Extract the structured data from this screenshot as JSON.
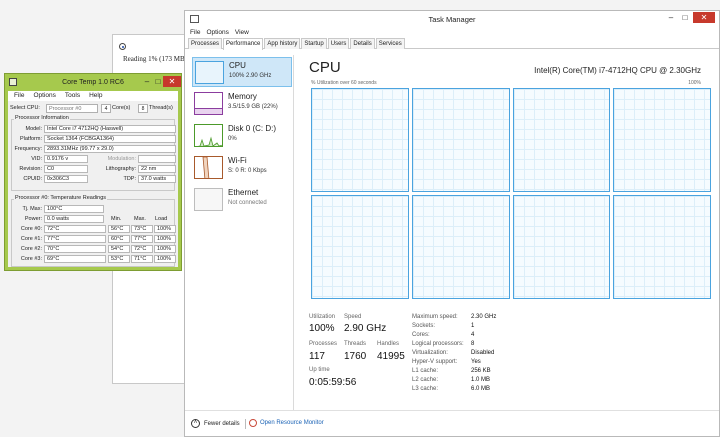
{
  "background_window": {
    "text": "Reading 1% (173 MB)"
  },
  "coretemp": {
    "title": "Core Temp 1.0 RC6",
    "menu": [
      "File",
      "Options",
      "Tools",
      "Help"
    ],
    "select_cpu_label": "Select CPU:",
    "select_cpu_value": "Processor #0",
    "cores_value": "4",
    "cores_label": "Core(s)",
    "threads_value": "8",
    "threads_label": "Thread(s)",
    "proc_info_title": "Processor Information",
    "model_label": "Model:",
    "model_value": "Intel Core i7 4712HQ (Haswell)",
    "platform_label": "Platform:",
    "platform_value": "Socket 1364 (FCBGA1364)",
    "frequency_label": "Frequency:",
    "frequency_value": "2893.31MHz (99.77 x 29.0)",
    "vid_label": "VID:",
    "vid_value": "0.9176 v",
    "modulation_label": "Modulation:",
    "modulation_value": "",
    "revision_label": "Revision:",
    "revision_value": "C0",
    "lithography_label": "Lithography:",
    "lithography_value": "22 nm",
    "cpuid_label": "CPUID:",
    "cpuid_value": "0x306C3",
    "tdp_label": "TDP:",
    "tdp_value": "37.0 watts",
    "temp_title": "Processor #0: Temperature Readings",
    "tjmax_label": "Tj. Max:",
    "tjmax_value": "100°C",
    "power_label": "Power:",
    "power_value": "0.0 watts",
    "col_min": "Min.",
    "col_max": "Max.",
    "col_load": "Load",
    "cores": [
      {
        "label": "Core #0:",
        "temp": "72°C",
        "min": "56°C",
        "max": "73°C",
        "load": "100%"
      },
      {
        "label": "Core #1:",
        "temp": "77°C",
        "min": "60°C",
        "max": "77°C",
        "load": "100%"
      },
      {
        "label": "Core #2:",
        "temp": "70°C",
        "min": "54°C",
        "max": "72°C",
        "load": "100%"
      },
      {
        "label": "Core #3:",
        "temp": "69°C",
        "min": "53°C",
        "max": "71°C",
        "load": "100%"
      }
    ]
  },
  "taskmanager": {
    "title": "Task Manager",
    "menu": [
      "File",
      "Options",
      "View"
    ],
    "tabs": [
      "Processes",
      "Performance",
      "App history",
      "Startup",
      "Users",
      "Details",
      "Services"
    ],
    "active_tab": 1,
    "sidebar": [
      {
        "name": "CPU",
        "sub": "100% 2.90 GHz",
        "color": "#4aa3df"
      },
      {
        "name": "Memory",
        "sub": "3.5/15.9 GB (22%)",
        "color": "#8b3d9e"
      },
      {
        "name": "Disk 0 (C: D:)",
        "sub": "0%",
        "color": "#4c9a2a"
      },
      {
        "name": "Wi-Fi",
        "sub": "S: 0 R: 0 Kbps",
        "color": "#a85a2c"
      },
      {
        "name": "Ethernet",
        "sub": "Not connected",
        "color": "#999999"
      }
    ],
    "cpu_title": "CPU",
    "cpu_name": "Intel(R) Core(TM) i7-4712HQ CPU @ 2.30GHz",
    "util_label": "% Utilization over 60 seconds",
    "util_max": "100%",
    "stats": {
      "utilization_label": "Utilization",
      "utilization_value": "100%",
      "speed_label": "Speed",
      "speed_value": "2.90 GHz",
      "processes_label": "Processes",
      "processes_value": "117",
      "threads_label": "Threads",
      "threads_value": "1760",
      "handles_label": "Handles",
      "handles_value": "41995",
      "uptime_label": "Up time",
      "uptime_value": "0:05:59:56"
    },
    "specs": [
      {
        "k": "Maximum speed:",
        "v": "2.30 GHz"
      },
      {
        "k": "Sockets:",
        "v": "1"
      },
      {
        "k": "Cores:",
        "v": "4"
      },
      {
        "k": "Logical processors:",
        "v": "8"
      },
      {
        "k": "Virtualization:",
        "v": "Disabled"
      },
      {
        "k": "Hyper-V support:",
        "v": "Yes"
      },
      {
        "k": "L1 cache:",
        "v": "256 KB"
      },
      {
        "k": "L2 cache:",
        "v": "1.0 MB"
      },
      {
        "k": "L3 cache:",
        "v": "6.0 MB"
      }
    ],
    "fewer_details": "Fewer details",
    "open_resource_monitor": "Open Resource Monitor"
  }
}
